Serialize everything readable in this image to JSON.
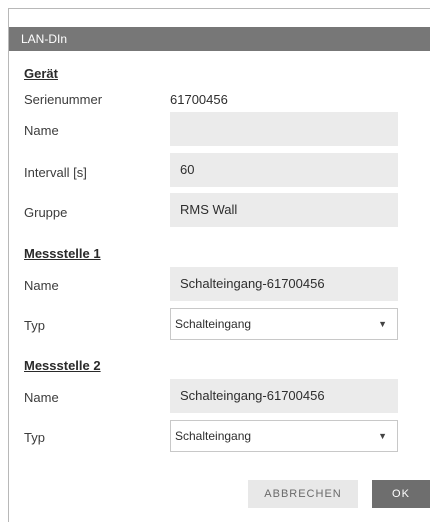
{
  "dialog": {
    "title": "LAN-DIn"
  },
  "geraet": {
    "heading": "Gerät",
    "serial_label": "Serienummer",
    "serial_value": "61700456",
    "name_label": "Name",
    "name_value": "",
    "interval_label": "Intervall [s]",
    "interval_value": "60",
    "group_label": "Gruppe",
    "group_value": "RMS Wall"
  },
  "messstelle1": {
    "heading": "Messstelle 1",
    "name_label": "Name",
    "name_value": "Schalteingang-61700456",
    "type_label": "Typ",
    "type_value": "Schalteingang"
  },
  "messstelle2": {
    "heading": "Messstelle 2",
    "name_label": "Name",
    "name_value": "Schalteingang-61700456",
    "type_label": "Typ",
    "type_value": "Schalteingang"
  },
  "buttons": {
    "cancel_label": "ABBRECHEN",
    "ok_label": "OK"
  },
  "icons": {
    "dropdown": "dropdown-arrow-icon"
  }
}
